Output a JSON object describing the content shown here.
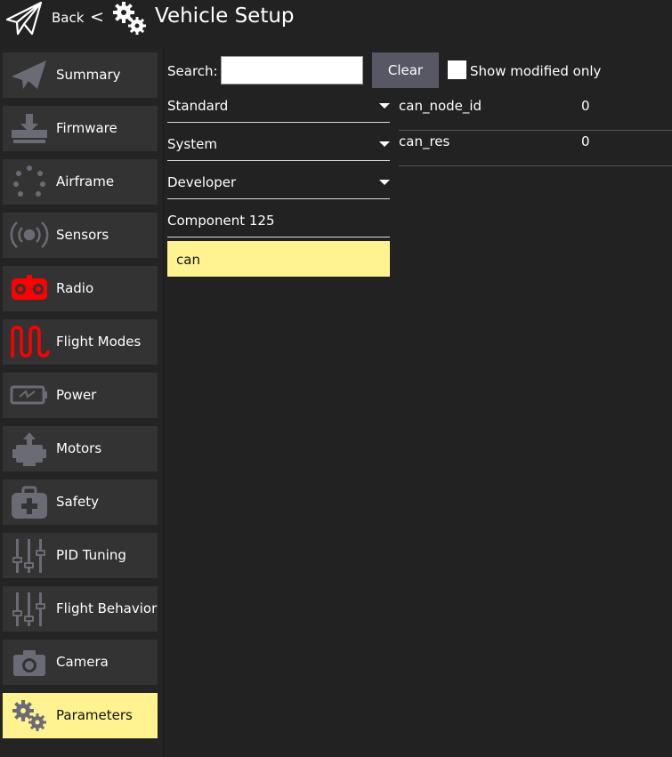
{
  "header": {
    "back_label": "Back",
    "separator": "<",
    "title": "Vehicle Setup"
  },
  "sidebar": {
    "items": [
      {
        "label": "Summary",
        "icon": "paper-plane-icon"
      },
      {
        "label": "Firmware",
        "icon": "download-icon"
      },
      {
        "label": "Airframe",
        "icon": "dots-circle-icon"
      },
      {
        "label": "Sensors",
        "icon": "radio-waves-icon"
      },
      {
        "label": "Radio",
        "icon": "radio-controller-icon"
      },
      {
        "label": "Flight Modes",
        "icon": "wave-icon"
      },
      {
        "label": "Power",
        "icon": "battery-icon"
      },
      {
        "label": "Motors",
        "icon": "motor-icon"
      },
      {
        "label": "Safety",
        "icon": "medkit-icon"
      },
      {
        "label": "PID Tuning",
        "icon": "sliders-icon"
      },
      {
        "label": "Flight Behavior",
        "icon": "sliders-icon"
      },
      {
        "label": "Camera",
        "icon": "camera-icon"
      },
      {
        "label": "Parameters",
        "icon": "gears-icon",
        "active": true
      }
    ]
  },
  "search": {
    "label": "Search:",
    "value": "",
    "clear_label": "Clear",
    "modified_only_label": "Show modified only",
    "modified_only_checked": false
  },
  "groups": [
    {
      "label": "Standard",
      "expandable": true
    },
    {
      "label": "System",
      "expandable": true
    },
    {
      "label": "Developer",
      "expandable": true
    },
    {
      "label": "Component 125",
      "expandable": false
    }
  ],
  "selected_group": "can",
  "params": [
    {
      "name": "can_node_id",
      "value": "0"
    },
    {
      "name": "can_res",
      "value": "0"
    }
  ],
  "colors": {
    "background": "#222222",
    "button": "#333333",
    "accent": "#fff291",
    "red_icon": "#ff0000"
  }
}
